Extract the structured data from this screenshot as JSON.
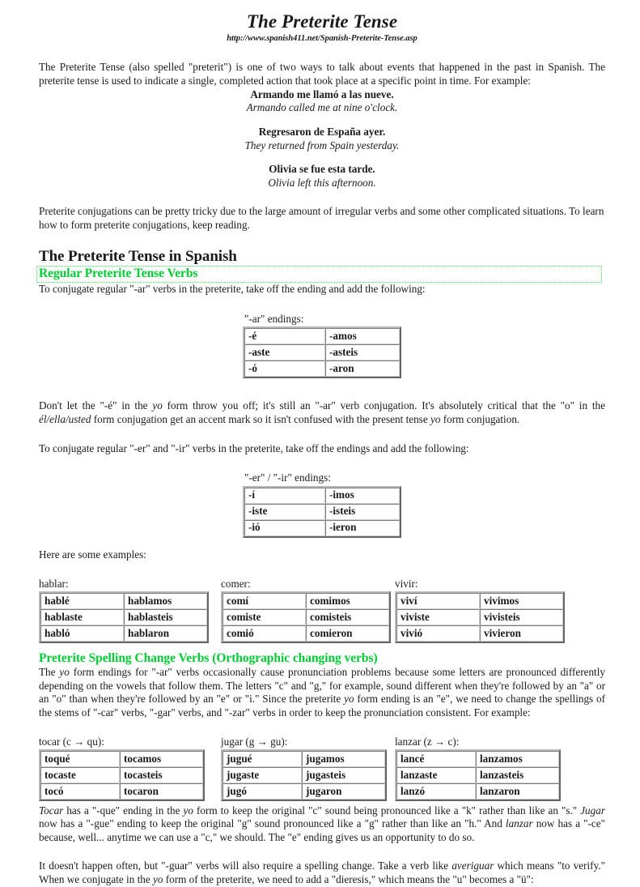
{
  "document": {
    "title": "The Preterite Tense",
    "url": "http://www.spanish411.net/Spanish-Preterite-Tense.asp",
    "accent_green": "#00cc33",
    "text_color": "#1a1a1a"
  },
  "intro": {
    "paragraph": "The Preterite Tense (also spelled \"preterit\") is one of two ways to talk about events that happened in the past in Spanish. The preterite tense is used to indicate a single, completed action that took place at a specific point in time. For example:",
    "examples": [
      {
        "spanish": "Armando me llamó a las nueve.",
        "english": "Armando called me at nine o'clock."
      },
      {
        "spanish": "Regresaron de España ayer.",
        "english": "They returned from Spain yesterday."
      },
      {
        "spanish": "Olivia se fue esta tarde.",
        "english": "Olivia left this afternoon."
      }
    ],
    "closing": "Preterite conjugations can be pretty tricky due to the large amount of irregular verbs and some other complicated situations. To learn how to form preterite conjugations, keep reading."
  },
  "section_spanish": {
    "heading": "The Preterite Tense in Spanish",
    "sub_heading": "Regular Preterite Tense Verbs",
    "ar_intro": "To conjugate regular \"-ar\" verbs in the preterite, take off the ending and add the following:",
    "ar_table": {
      "label": "\"-ar\" endings:",
      "rows": [
        [
          "-é",
          "-amos"
        ],
        [
          "-aste",
          "-asteis"
        ],
        [
          "-ó",
          "-aron"
        ]
      ]
    },
    "ar_note_a": "Don't let the \"-é\" in the ",
    "ar_note_yo1": "yo",
    "ar_note_b": " form throw you off; it's still an \"-ar\" verb conjugation. It's absolutely critical that the \"o\" in the ",
    "ar_note_elella": "él/ella/usted",
    "ar_note_c": " form conjugation get an accent mark so it isn't confused with the present tense ",
    "ar_note_yo2": "yo",
    "ar_note_d": " form conjugation.",
    "er_ir_intro": "To conjugate regular \"-er\" and \"-ir\" verbs in the preterite, take off the endings and add the following:",
    "er_ir_table": {
      "label": "\"-er\" / \"-ir\" endings:",
      "rows": [
        [
          "-í",
          "-imos"
        ],
        [
          "-iste",
          "-isteis"
        ],
        [
          "-ió",
          "-ieron"
        ]
      ]
    },
    "examples_intro": "Here are some examples:",
    "example_tables": [
      {
        "label": "hablar:",
        "rows": [
          [
            "hablé",
            "hablamos"
          ],
          [
            "hablaste",
            "hablasteis"
          ],
          [
            "habló",
            "hablaron"
          ]
        ]
      },
      {
        "label": "comer:",
        "rows": [
          [
            "comí",
            "comimos"
          ],
          [
            "comiste",
            "comisteis"
          ],
          [
            "comió",
            "comieron"
          ]
        ]
      },
      {
        "label": "vivir:",
        "rows": [
          [
            "viví",
            "vivimos"
          ],
          [
            "viviste",
            "vivisteis"
          ],
          [
            "vivió",
            "vivieron"
          ]
        ]
      }
    ]
  },
  "section_spelling": {
    "heading": "Preterite Spelling Change Verbs (Orthographic changing verbs)",
    "para_a": "The ",
    "para_yo1": "yo",
    "para_b": " form endings for \"-ar\" verbs occasionally cause pronunciation problems because some letters are pronounced differently depending on the vowels that follow them. The letters \"c\" and \"g,\" for example, sound different when they're followed by an \"a\" or an \"o\" than when they're followed by an \"e\" or \"i.\" Since the preterite ",
    "para_yo2": "yo",
    "para_c": " form ending is an \"e\", we need to change the spellings of the stems of \"-car\" verbs, \"-gar\" verbs, and \"-zar\" verbs in order to keep the pronunciation consistent. For example:",
    "tables": [
      {
        "label": "tocar (c → qu):",
        "rows": [
          [
            "toqué",
            "tocamos"
          ],
          [
            "tocaste",
            "tocasteis"
          ],
          [
            "tocó",
            "tocaron"
          ]
        ]
      },
      {
        "label": "jugar (g → gu):",
        "rows": [
          [
            "jugué",
            "jugamos"
          ],
          [
            "jugaste",
            "jugasteis"
          ],
          [
            "jugó",
            "jugaron"
          ]
        ]
      },
      {
        "label": "lanzar (z → c):",
        "rows": [
          [
            "lancé",
            "lanzamos"
          ],
          [
            "lanzaste",
            "lanzasteis"
          ],
          [
            "lanzó",
            "lanzaron"
          ]
        ]
      }
    ],
    "note_tocar": "Tocar",
    "note_a": " has a \"-que\" ending in the ",
    "note_yo1": "yo",
    "note_b": " form to keep the original \"c\" sound being pronounced like a \"k\" rather than like an \"s.\" ",
    "note_jugar": "Jugar",
    "note_c": " now has a \"-gue\" ending to keep the original \"g\" sound pronounced like a \"g\" rather than like an \"h.\" And ",
    "note_lanzar": "lanzar",
    "note_d": " now has a \"-ce\" because, well... anytime we can use a \"c,\" we should. The \"e\" ending gives us an opportunity to do so.",
    "guar_a": "It doesn't happen often, but \"-guar\" verbs will also require a spelling change. Take a verb like ",
    "guar_averiguar": "averiguar",
    "guar_b": " which means \"to verify.\" When we conjugate in the ",
    "guar_yo": "yo",
    "guar_c": " form of the preterite, we need to add a \"dieresis,\" which means the \"u\" becomes a \"ü\":"
  }
}
